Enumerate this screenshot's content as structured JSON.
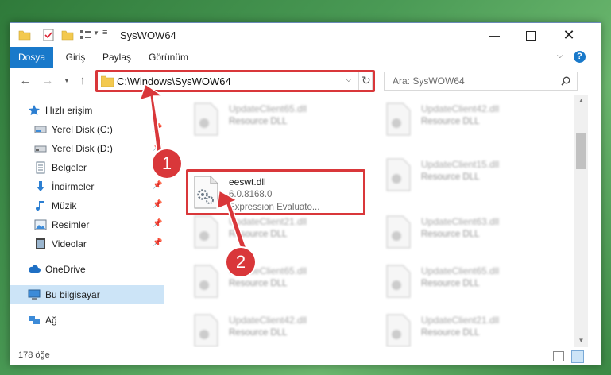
{
  "window": {
    "title": "SysWOW64"
  },
  "ribbon": {
    "tabs": [
      {
        "label": "Dosya",
        "active": true
      },
      {
        "label": "Giriş",
        "active": false
      },
      {
        "label": "Paylaş",
        "active": false
      },
      {
        "label": "Görünüm",
        "active": false
      }
    ]
  },
  "address": {
    "path": "C:\\Windows\\SysWOW64"
  },
  "search": {
    "placeholder": "Ara: SysWOW64"
  },
  "sidebar": {
    "items": [
      {
        "label": "Hızlı erişim",
        "icon": "star-icon"
      },
      {
        "label": "Yerel Disk (C:)",
        "icon": "drive-icon"
      },
      {
        "label": "Yerel Disk (D:)",
        "icon": "drive-icon"
      },
      {
        "label": "Belgeler",
        "icon": "documents-icon"
      },
      {
        "label": "İndirmeler",
        "icon": "download-icon"
      },
      {
        "label": "Müzik",
        "icon": "music-icon"
      },
      {
        "label": "Resimler",
        "icon": "pictures-icon"
      },
      {
        "label": "Videolar",
        "icon": "video-icon"
      },
      {
        "label": "OneDrive",
        "icon": "cloud-icon"
      },
      {
        "label": "Bu bilgisayar",
        "icon": "computer-icon"
      },
      {
        "label": "Ağ",
        "icon": "network-icon"
      }
    ]
  },
  "files": {
    "main": {
      "name": "eeswt.dll",
      "version": "6.0.8168.0",
      "description": "Expression Evaluato..."
    },
    "blurred": [
      {
        "name": "UpdateClient65.dll",
        "type": "Resource DLL"
      },
      {
        "name": "UpdateClient42.dll",
        "type": "Resource DLL"
      },
      {
        "name": "UpdateClient15.dll",
        "type": "Resource DLL"
      },
      {
        "name": "UpdateClient21.dll",
        "type": "Resource DLL"
      },
      {
        "name": "UpdateClient63.dll",
        "type": "Resource DLL"
      },
      {
        "name": "UpdateClient65.dll",
        "type": "Resource DLL"
      },
      {
        "name": "UpdateClient65.dll",
        "type": "Resource DLL"
      },
      {
        "name": "UpdateClient42.dll",
        "type": "Resource DLL"
      },
      {
        "name": "UpdateClient21.dll",
        "type": "Resource DLL"
      }
    ]
  },
  "status": {
    "count": "178 öğe"
  },
  "annotations": {
    "badge1": "1",
    "badge2": "2",
    "color": "#d9373a"
  }
}
